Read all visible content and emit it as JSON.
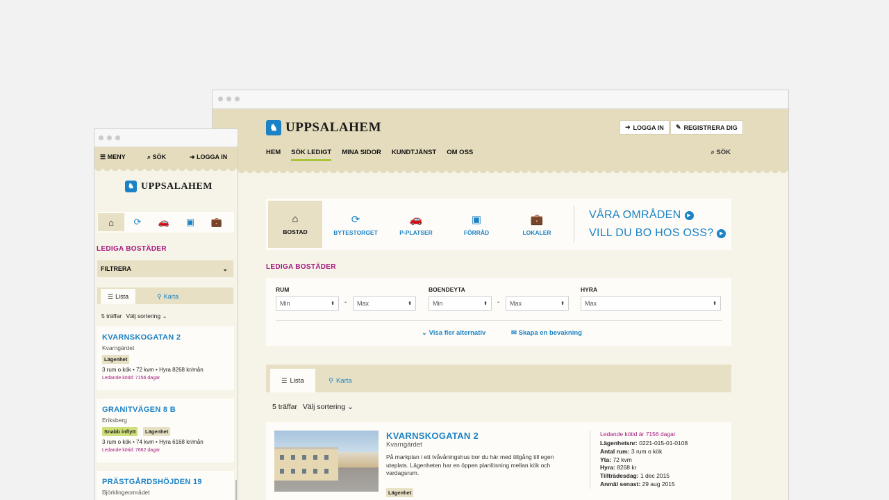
{
  "brand": {
    "name": "UPPSALAHEM",
    "logo_icon": "lion-shield-logo",
    "accent": "#1b82c5",
    "magenta": "#a3177d",
    "header_bg": "#e4dcbd"
  },
  "desktop": {
    "header": {
      "login": "LOGGA IN",
      "register": "REGISTRERA DIG",
      "search": "SÖK"
    },
    "nav": [
      "HEM",
      "SÖK LEDIGT",
      "MINA SIDOR",
      "KUNDTJÄNST",
      "OM OSS"
    ],
    "categories": [
      {
        "label": "BOSTAD",
        "icon": "home-icon"
      },
      {
        "label": "BYTESTORGET",
        "icon": "refresh-icon"
      },
      {
        "label": "P-PLATSER",
        "icon": "car-icon"
      },
      {
        "label": "FÖRRÅD",
        "icon": "box-icon"
      },
      {
        "label": "LOKALER",
        "icon": "briefcase-icon"
      }
    ],
    "promos": [
      "VÅRA OMRÅDEN",
      "VILL DU BO HOS OSS?"
    ],
    "section_title": "LEDIGA BOSTÄDER",
    "filters": {
      "rum_label": "RUM",
      "boendeyta_label": "BOENDEYTA",
      "hyra_label": "HYRA",
      "rum_min": "Min",
      "rum_max": "Max",
      "yta_min": "Min",
      "yta_max": "Max",
      "hyra_max": "Max",
      "dash": "-",
      "more_options": "Visa fler alternativ",
      "create_watch": "Skapa en bevakning"
    },
    "tabs": {
      "list": "Lista",
      "map": "Karta"
    },
    "hits": "5 träffar",
    "sort": "Välj sortering",
    "listing": {
      "title": "KVARNSKOGATAN 2",
      "area": "Kvarngärdet",
      "description": "På markplan i ett tvåvåningshus bor du här med tillgång till egen uteplats. Lägenheten har en öppen planlösning mellan kök och vardagsrum.",
      "badge": "Lägenhet",
      "lead": "Ledande kötid är 7156 dagar",
      "facts": [
        {
          "k": "Lägenhetsnr:",
          "v": "0221-015-01-0108"
        },
        {
          "k": "Antal rum:",
          "v": "3 rum o kök"
        },
        {
          "k": "Yta:",
          "v": "72 kvm"
        },
        {
          "k": "Hyra:",
          "v": "8268 kr"
        },
        {
          "k": "Tillträdesdag:",
          "v": "1 dec 2015"
        },
        {
          "k": "Anmäl senast:",
          "v": "29 aug 2015"
        }
      ]
    }
  },
  "mobile": {
    "header": {
      "menu": "MENY",
      "search": "SÖK",
      "login": "LOGGA IN"
    },
    "section_title": "LEDIGA BOSTÄDER",
    "filter": "FILTRERA",
    "tabs": {
      "list": "Lista",
      "map": "Karta"
    },
    "hits": "5 träffar",
    "sort": "Välj sortering",
    "cards": [
      {
        "title": "KVARNSKOGATAN 2",
        "area": "Kvarngärdet",
        "badges": [
          "Lägenhet"
        ],
        "info": "3 rum o kök  •  72 kvm  •  Hyra 8268 kr/mån",
        "lead": "Ledande kötid: 7156 dagar"
      },
      {
        "title": "GRANITVÄGEN 8 B",
        "area": "Eriksberg",
        "badges": [
          "Snabb inflytt",
          "Lägenhet"
        ],
        "info": "3 rum o kök  •  74 kvm  •  Hyra 6168 kr/mån",
        "lead": "Ledande kötid: 7662 dagar"
      },
      {
        "title": "PRÄSTGÅRDSHÖJDEN 19",
        "area": "Björklingeområdet"
      }
    ]
  }
}
